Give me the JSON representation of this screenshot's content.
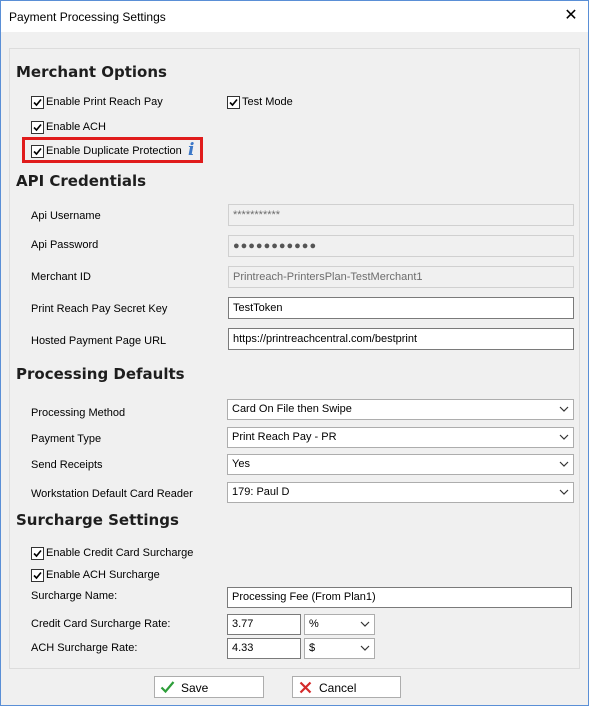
{
  "window": {
    "title": "Payment Processing Settings",
    "close_label": "✕"
  },
  "merchant": {
    "heading": "Merchant Options",
    "enable_prp_label": "Enable Print Reach Pay",
    "test_mode_label": "Test Mode",
    "enable_ach_label": "Enable ACH",
    "dup_label": "Enable Duplicate Protection",
    "info_glyph": "i",
    "highlight_color": "#e01b1b"
  },
  "api": {
    "heading": "API Credentials",
    "username_label": "Api Username",
    "username_value": "***********",
    "password_label": "Api Password",
    "password_value": "●●●●●●●●●●●",
    "merchant_id_label": "Merchant ID",
    "merchant_id_value": "Printreach-PrintersPlan-TestMerchant1",
    "secret_label": "Print Reach Pay Secret Key",
    "secret_value": "TestToken",
    "url_label": "Hosted Payment Page URL",
    "url_value": "https://printreachcentral.com/bestprint"
  },
  "defaults": {
    "heading": "Processing Defaults",
    "method_label": "Processing Method",
    "method_value": "Card On File then Swipe",
    "type_label": "Payment Type",
    "type_value": "Print Reach Pay - PR",
    "receipts_label": "Send Receipts",
    "receipts_value": "Yes",
    "reader_label": "Workstation Default Card Reader",
    "reader_value": "179: Paul D"
  },
  "surcharge": {
    "heading": "Surcharge Settings",
    "cc_enable_label": "Enable Credit Card Surcharge",
    "ach_enable_label": "Enable ACH Surcharge",
    "name_label": "Surcharge Name:",
    "name_value": "Processing Fee (From Plan1)",
    "cc_rate_label": "Credit Card Surcharge Rate:",
    "cc_rate_value": "3.77",
    "cc_unit": "%",
    "ach_rate_label": "ACH Surcharge Rate:",
    "ach_rate_value": "4.33",
    "ach_unit": "$"
  },
  "buttons": {
    "save_label": "Save",
    "cancel_label": "Cancel",
    "save_color": "#2e9e3a",
    "cancel_color": "#d42a2a"
  }
}
